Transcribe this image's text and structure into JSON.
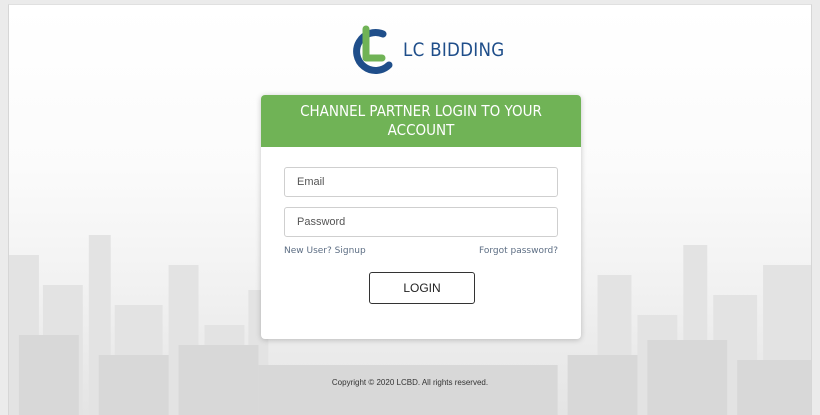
{
  "brand": {
    "name": "LC BIDDING",
    "colors": {
      "blue": "#1f4e8a",
      "green": "#70b356"
    }
  },
  "login_card": {
    "title": "CHANNEL PARTNER LOGIN TO YOUR ACCOUNT",
    "email_placeholder": "Email",
    "password_placeholder": "Password",
    "signup_link": "New User? Signup",
    "forgot_link": "Forgot password?",
    "login_button": "LOGIN"
  },
  "footer": {
    "copyright": "Copyright © 2020 LCBD. All rights reserved."
  }
}
